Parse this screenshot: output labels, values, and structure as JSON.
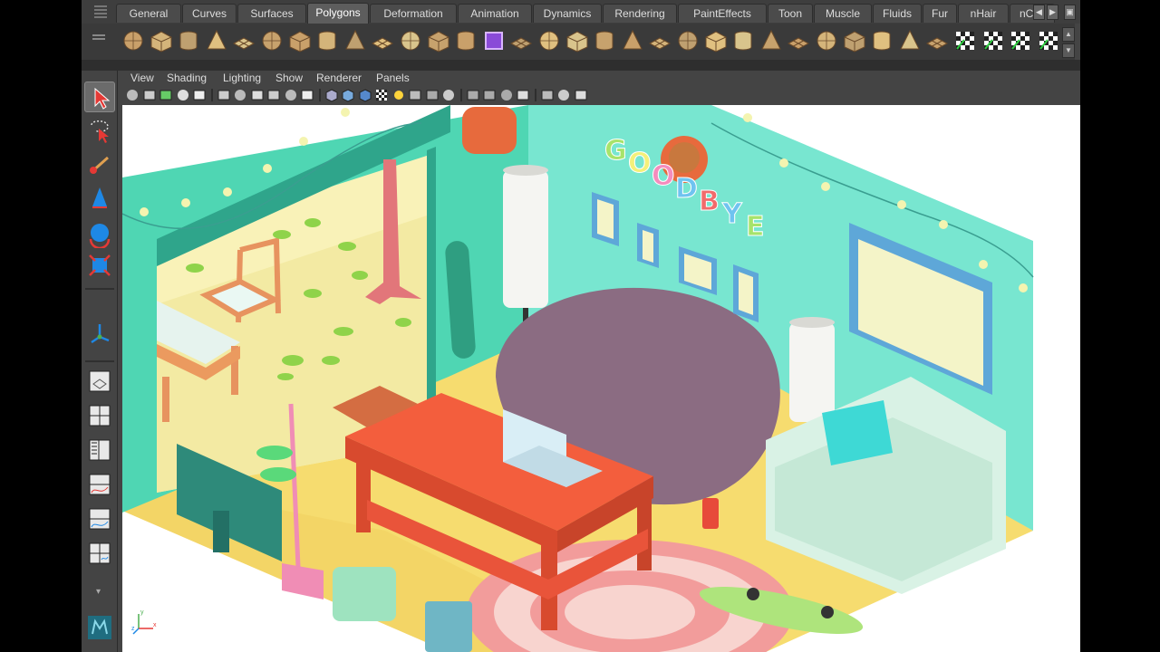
{
  "shelf": {
    "tabs": [
      {
        "label": "General"
      },
      {
        "label": "Curves"
      },
      {
        "label": "Surfaces"
      },
      {
        "label": "Polygons",
        "active": true
      },
      {
        "label": "Deformation"
      },
      {
        "label": "Animation"
      },
      {
        "label": "Dynamics"
      },
      {
        "label": "Rendering"
      },
      {
        "label": "PaintEffects"
      },
      {
        "label": "Toon"
      },
      {
        "label": "Muscle"
      },
      {
        "label": "Fluids"
      },
      {
        "label": "Fur"
      },
      {
        "label": "nHair"
      },
      {
        "label": "nClot"
      }
    ],
    "icons": [
      "poly-sphere-icon",
      "poly-cube-icon",
      "poly-cylinder-icon",
      "poly-cone-icon",
      "poly-plane-icon",
      "poly-torus-icon",
      "poly-pyramid-icon",
      "poly-pipe-icon",
      "soccer-ball-icon",
      "combine-icon",
      "separate-icon",
      "boolean-icon",
      "smooth-cube-icon",
      "create-polygon-icon",
      "append-polygon-icon",
      "extrude-icon",
      "bridge-icon",
      "bevel-icon",
      "merge-icon",
      "split-icon",
      "insert-loop-icon",
      "offset-loop-icon",
      "fill-hole-icon",
      "reduce-icon",
      "soften-icon",
      "harden-icon",
      "triangulate-icon",
      "mirror-icon",
      "quadrangulate-icon",
      "uv-editor-icon",
      "planar-map-icon",
      "cylindrical-map-icon",
      "spherical-map-icon",
      "auto-map-icon"
    ]
  },
  "panel_menu": {
    "items": [
      {
        "label": "View"
      },
      {
        "label": "Shading"
      },
      {
        "label": "Lighting"
      },
      {
        "label": "Show"
      },
      {
        "label": "Renderer"
      },
      {
        "label": "Panels"
      }
    ]
  },
  "panel_tools": [
    "select-camera-icon",
    "camera-attr-icon",
    "bookmark-icon",
    "image-plane-icon",
    "grid-toggle-icon",
    "film-gate-icon",
    "resolution-gate-icon",
    "gate-mask-icon",
    "field-chart-icon",
    "safe-action-icon",
    "safe-title-icon",
    "wireframe-icon",
    "smooth-shade-icon",
    "wireframe-on-shaded-icon",
    "textured-icon",
    "use-lights-icon",
    "shadows-icon",
    "xray-icon",
    "isolate-select-icon",
    "viewport2-icon",
    "ambient-occlusion-icon",
    "motion-blur-icon",
    "multisample-icon",
    "bounding-box-icon",
    "backface-icon",
    "component-icon"
  ],
  "toolbox": [
    "select-tool-icon",
    "lasso-tool-icon",
    "paint-select-icon",
    "move-tool-icon",
    "rotate-tool-icon",
    "scale-tool-icon",
    "manipulator-icon",
    "single-view-icon",
    "four-view-icon",
    "outliner-layout-icon",
    "graph-layout-icon",
    "hypershade-layout-icon",
    "script-layout-icon",
    "menu-more-icon",
    "maya-logo-icon"
  ],
  "viewport": {
    "banner_letters": [
      "G",
      "O",
      "O",
      "D",
      "B",
      "Y",
      "E"
    ],
    "axis": {
      "x": "x",
      "y": "y",
      "z": "z"
    }
  },
  "colors": {
    "wall_left": "#4cd6b2",
    "wall_right": "#76e8d1",
    "floor": "#f5d86a",
    "beanbag": "#8a6b80",
    "table": "#f0603f",
    "armchair": "#d7f2e4",
    "rug_pink": "#f6a9a6"
  }
}
